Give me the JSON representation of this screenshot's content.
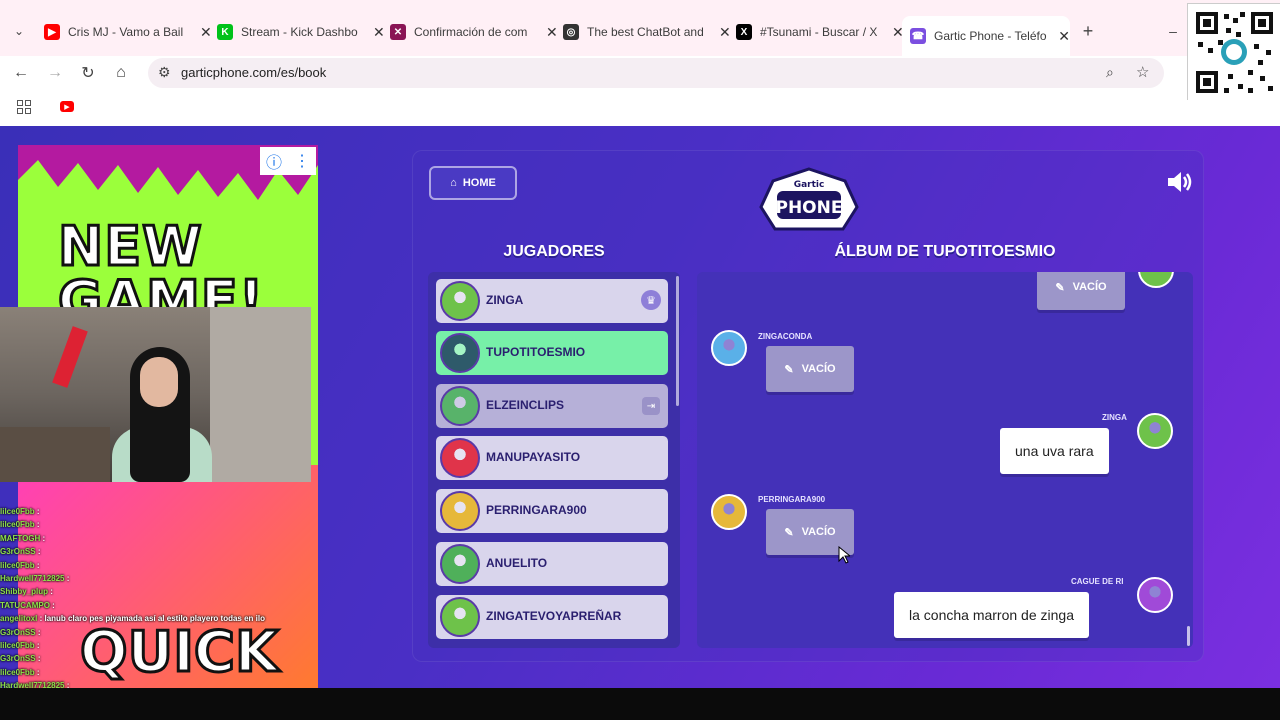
{
  "browser": {
    "tabs": [
      {
        "title": "Cris MJ - Vamo a Bail",
        "color": "#ff0000",
        "glyph": "▶"
      },
      {
        "title": "Stream - Kick Dashbo",
        "color": "#00c21a",
        "glyph": "K"
      },
      {
        "title": "Confirmación de com",
        "color": "#8a1455",
        "glyph": "✕"
      },
      {
        "title": "The best ChatBot and",
        "color": "#333333",
        "glyph": "◎"
      },
      {
        "title": "#Tsunami - Buscar / X",
        "color": "#000000",
        "glyph": "X"
      },
      {
        "title": "Gartic Phone - Teléfo",
        "color": "#7b4fe0",
        "glyph": "☎"
      }
    ],
    "url": "garticphone.com/es/book"
  },
  "ad": {
    "headline": "NEW GAME!",
    "footer": "QUICK"
  },
  "chat": [
    {
      "user": "lilce0Fbb",
      "msg": ":"
    },
    {
      "user": "lilce0Fbb",
      "msg": ":"
    },
    {
      "user": "MAFTOGH",
      "msg": ":"
    },
    {
      "user": "G3rOnSS",
      "msg": ":"
    },
    {
      "user": "lilce0Fbb",
      "msg": ":"
    },
    {
      "user": "Hardwell7712825",
      "msg": ":"
    },
    {
      "user": "Shibby_plup",
      "msg": ":"
    },
    {
      "user": "TATUCAMPO",
      "msg": ":"
    },
    {
      "user": "angelitoxl",
      "msg": ": lanub claro pes piyamada así al estilo playero todas en ilo"
    },
    {
      "user": "G3rOnSS",
      "msg": ":"
    },
    {
      "user": "lilce0Fbb",
      "msg": ":"
    },
    {
      "user": "G3rOnSS",
      "msg": ":"
    },
    {
      "user": "lilce0Fbb",
      "msg": ":"
    },
    {
      "user": "Hardwell7712825",
      "msg": ":"
    },
    {
      "user": "G3rOnSS",
      "msg": ":"
    }
  ],
  "game": {
    "home_label": "HOME",
    "players_heading": "JUGADORES",
    "album_heading": "ÁLBUM DE TUPOTITOESMIO",
    "players": [
      {
        "name": "ZINGA",
        "badge": "crown",
        "state": "normal",
        "avatar_color": "#6ec24a"
      },
      {
        "name": "TUPOTITOESMIO",
        "badge": "",
        "state": "selected",
        "avatar_color": "#2e5a6a"
      },
      {
        "name": "ELZEINCLIPS",
        "badge": "exit",
        "state": "dim",
        "avatar_color": "#58b36a"
      },
      {
        "name": "MANUPAYASITO",
        "badge": "",
        "state": "normal",
        "avatar_color": "#e0344a"
      },
      {
        "name": "PERRINGARA900",
        "badge": "",
        "state": "normal",
        "avatar_color": "#e6b83a"
      },
      {
        "name": "ANUELITO",
        "badge": "",
        "state": "normal",
        "avatar_color": "#4fb05a"
      },
      {
        "name": "ZINGATEVOYAPREÑAR",
        "badge": "",
        "state": "normal",
        "avatar_color": "#6ec24a"
      }
    ],
    "album": [
      {
        "user": "",
        "text": "VACÍO",
        "type": "empty",
        "side": "right"
      },
      {
        "user": "ZINGACONDA",
        "text": "VACÍO",
        "type": "empty",
        "side": "left",
        "avatar_color": "#5ab0e8"
      },
      {
        "user": "ZINGA",
        "text": "una uva rara",
        "type": "text",
        "side": "right",
        "avatar_color": "#6ec24a"
      },
      {
        "user": "PERRINGARA900",
        "text": "VACÍO",
        "type": "empty",
        "side": "left",
        "avatar_color": "#e6b83a"
      },
      {
        "user": "CAGUE DE RI",
        "text": "la concha marron de zinga",
        "type": "text",
        "side": "right",
        "avatar_color": "#a04ad8"
      }
    ]
  }
}
